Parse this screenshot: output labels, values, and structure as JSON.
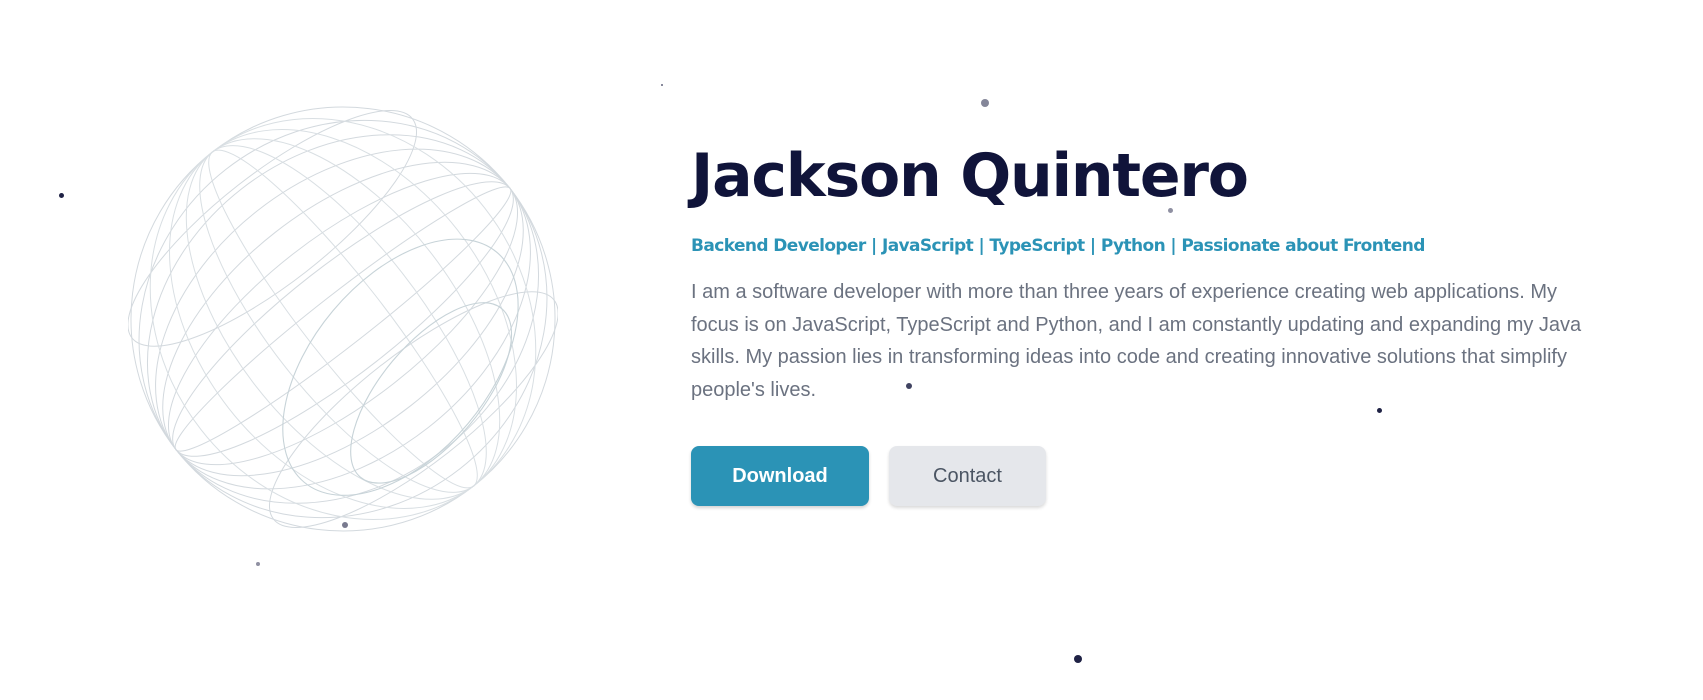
{
  "hero": {
    "name": "Jackson Quintero",
    "roles": "Backend Developer | JavaScript | TypeScript | Python | Passionate about Frontend",
    "bio": "I am a software developer with more than three years of experience creating web applications. My focus is on JavaScript, TypeScript and Python, and I am constantly updating and expanding my Java skills. My passion lies in transforming ideas into code and creating innovative solutions that simplify people's lives."
  },
  "actions": {
    "download_label": "Download",
    "contact_label": "Contact"
  },
  "colors": {
    "heading": "#10143a",
    "accent": "#2b93b6",
    "body_text": "#6b7280",
    "secondary_button": "#e5e7eb",
    "globe_lines": "#cfd6dc",
    "particles": "#1f2245"
  },
  "decoration": {
    "globe_icon": "wireframe-globe-icon",
    "particles_icon": "floating-particles"
  }
}
